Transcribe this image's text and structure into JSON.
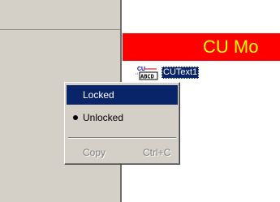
{
  "canvas": {
    "banner_text": "CU Mo",
    "banner_color": "#ff0000",
    "banner_text_color": "#ffff00",
    "component": {
      "icon": "cu-abcd-text-icon",
      "icon_top_text": "CU",
      "icon_bottom_text": "ABCD",
      "label": "CUText1"
    }
  },
  "context_menu": {
    "items": [
      {
        "label": "Locked",
        "state": "highlighted"
      },
      {
        "label": "Unlocked",
        "state": "checked"
      },
      {
        "label": "Copy",
        "shortcut": "Ctrl+C",
        "state": "disabled"
      }
    ]
  },
  "colors": {
    "selection": "#0a246a",
    "face": "#d4d0c8",
    "disabled_text": "#808080"
  }
}
